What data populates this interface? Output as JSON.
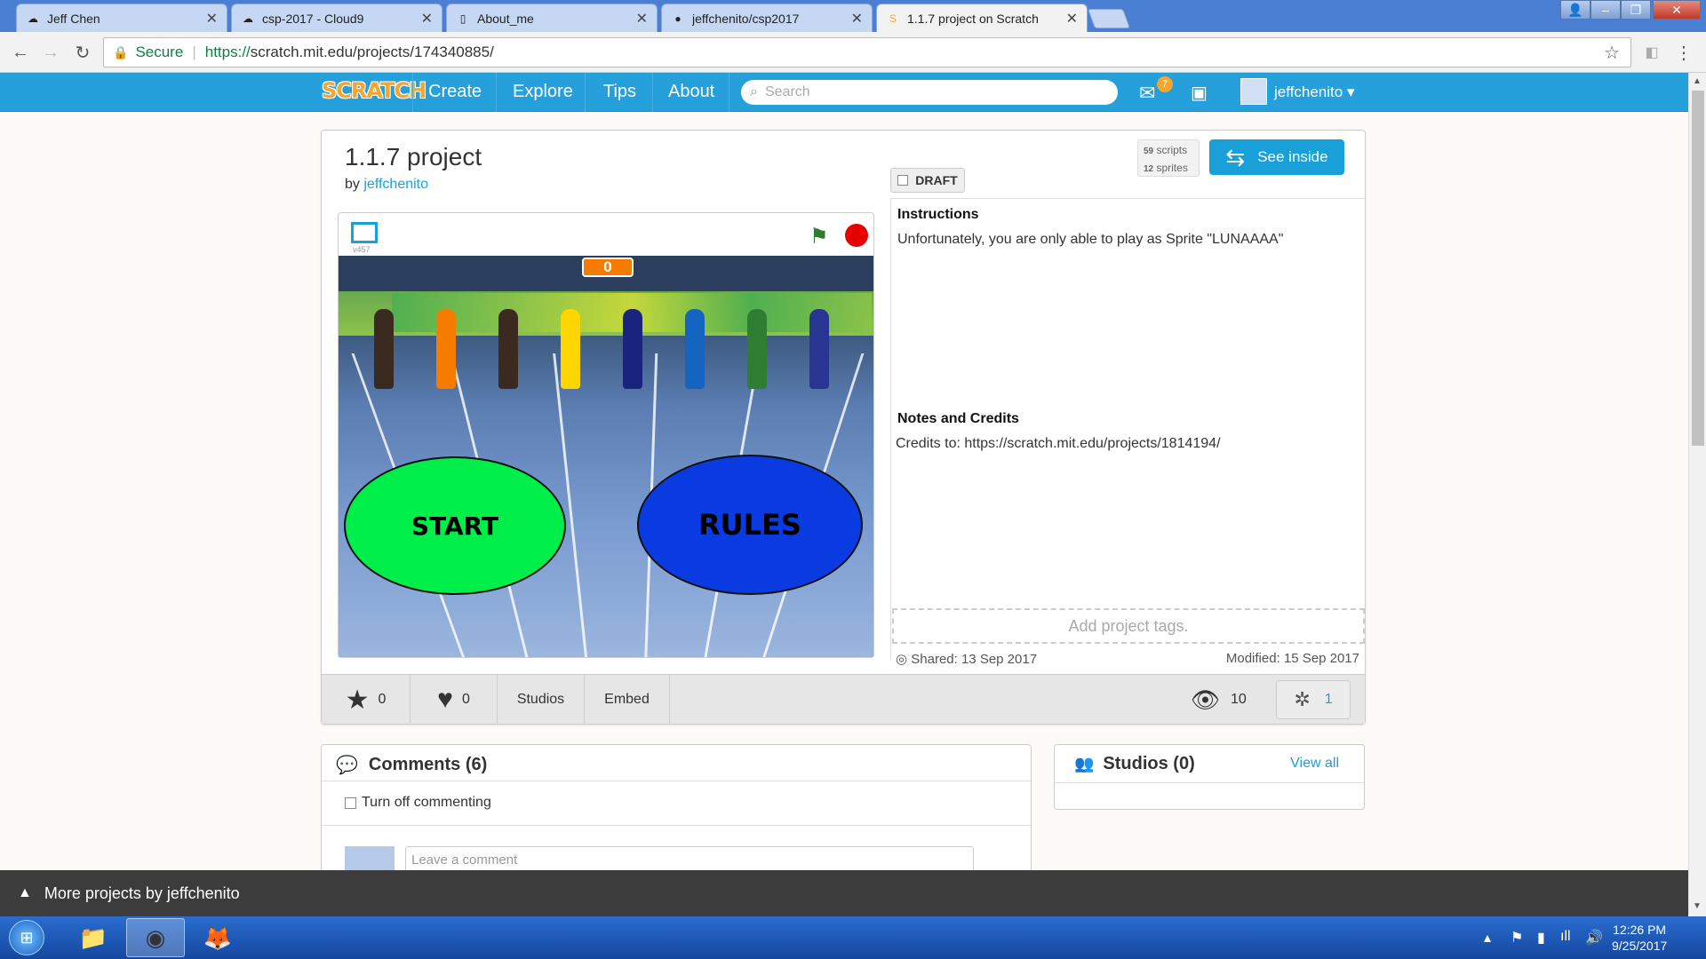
{
  "browser": {
    "tabs": [
      {
        "title": "Jeff Chen",
        "icon": "cloud9-icon"
      },
      {
        "title": "csp-2017 - Cloud9",
        "icon": "cloud9-icon"
      },
      {
        "title": "About_me",
        "icon": "document-icon"
      },
      {
        "title": "jeffchenito/csp2017",
        "icon": "github-icon"
      },
      {
        "title": "1.1.7 project on Scratch",
        "icon": "scratch-icon"
      }
    ],
    "secure_label": "Secure",
    "url_scheme": "https://",
    "url_host": "scratch.mit.edu",
    "url_path": "/projects/174340885/"
  },
  "scratch_nav": {
    "logo": "SCRATCH",
    "links": [
      "Create",
      "Explore",
      "Tips",
      "About"
    ],
    "search_placeholder": "Search",
    "messages_count": "7",
    "username": "jeffchenito"
  },
  "project": {
    "title": "1.1.7 project",
    "by_prefix": "by",
    "author": "jeffchenito",
    "draft_label": "DRAFT",
    "scripts_count": "59",
    "scripts_label": "scripts",
    "sprites_count": "12",
    "sprites_label": "sprites",
    "see_inside_label": "See inside",
    "player": {
      "version": "v457",
      "score": "0",
      "start_label": "START",
      "rules_label": "RULES"
    },
    "instructions_title": "Instructions",
    "instructions_text": "Unfortunately, you are only able to play as Sprite \"LUNAAAA\"",
    "notes_title": "Notes and Credits",
    "notes_text": "Credits to: https://scratch.mit.edu/projects/1814194/",
    "tags_placeholder": "Add project tags.",
    "shared": "Shared: 13 Sep 2017",
    "modified": "Modified: 15 Sep 2017",
    "favorites": "0",
    "loves": "0",
    "studios_label": "Studios",
    "embed_label": "Embed",
    "views": "10",
    "remixes": "1"
  },
  "comments": {
    "title": "Comments (6)",
    "turn_off_label": "Turn off commenting",
    "placeholder": "Leave a comment"
  },
  "studios": {
    "title": "Studios (0)",
    "view_all": "View all"
  },
  "more_projects": "More projects by jeffchenito",
  "taskbar": {
    "time": "12:26 PM",
    "date": "9/25/2017"
  }
}
